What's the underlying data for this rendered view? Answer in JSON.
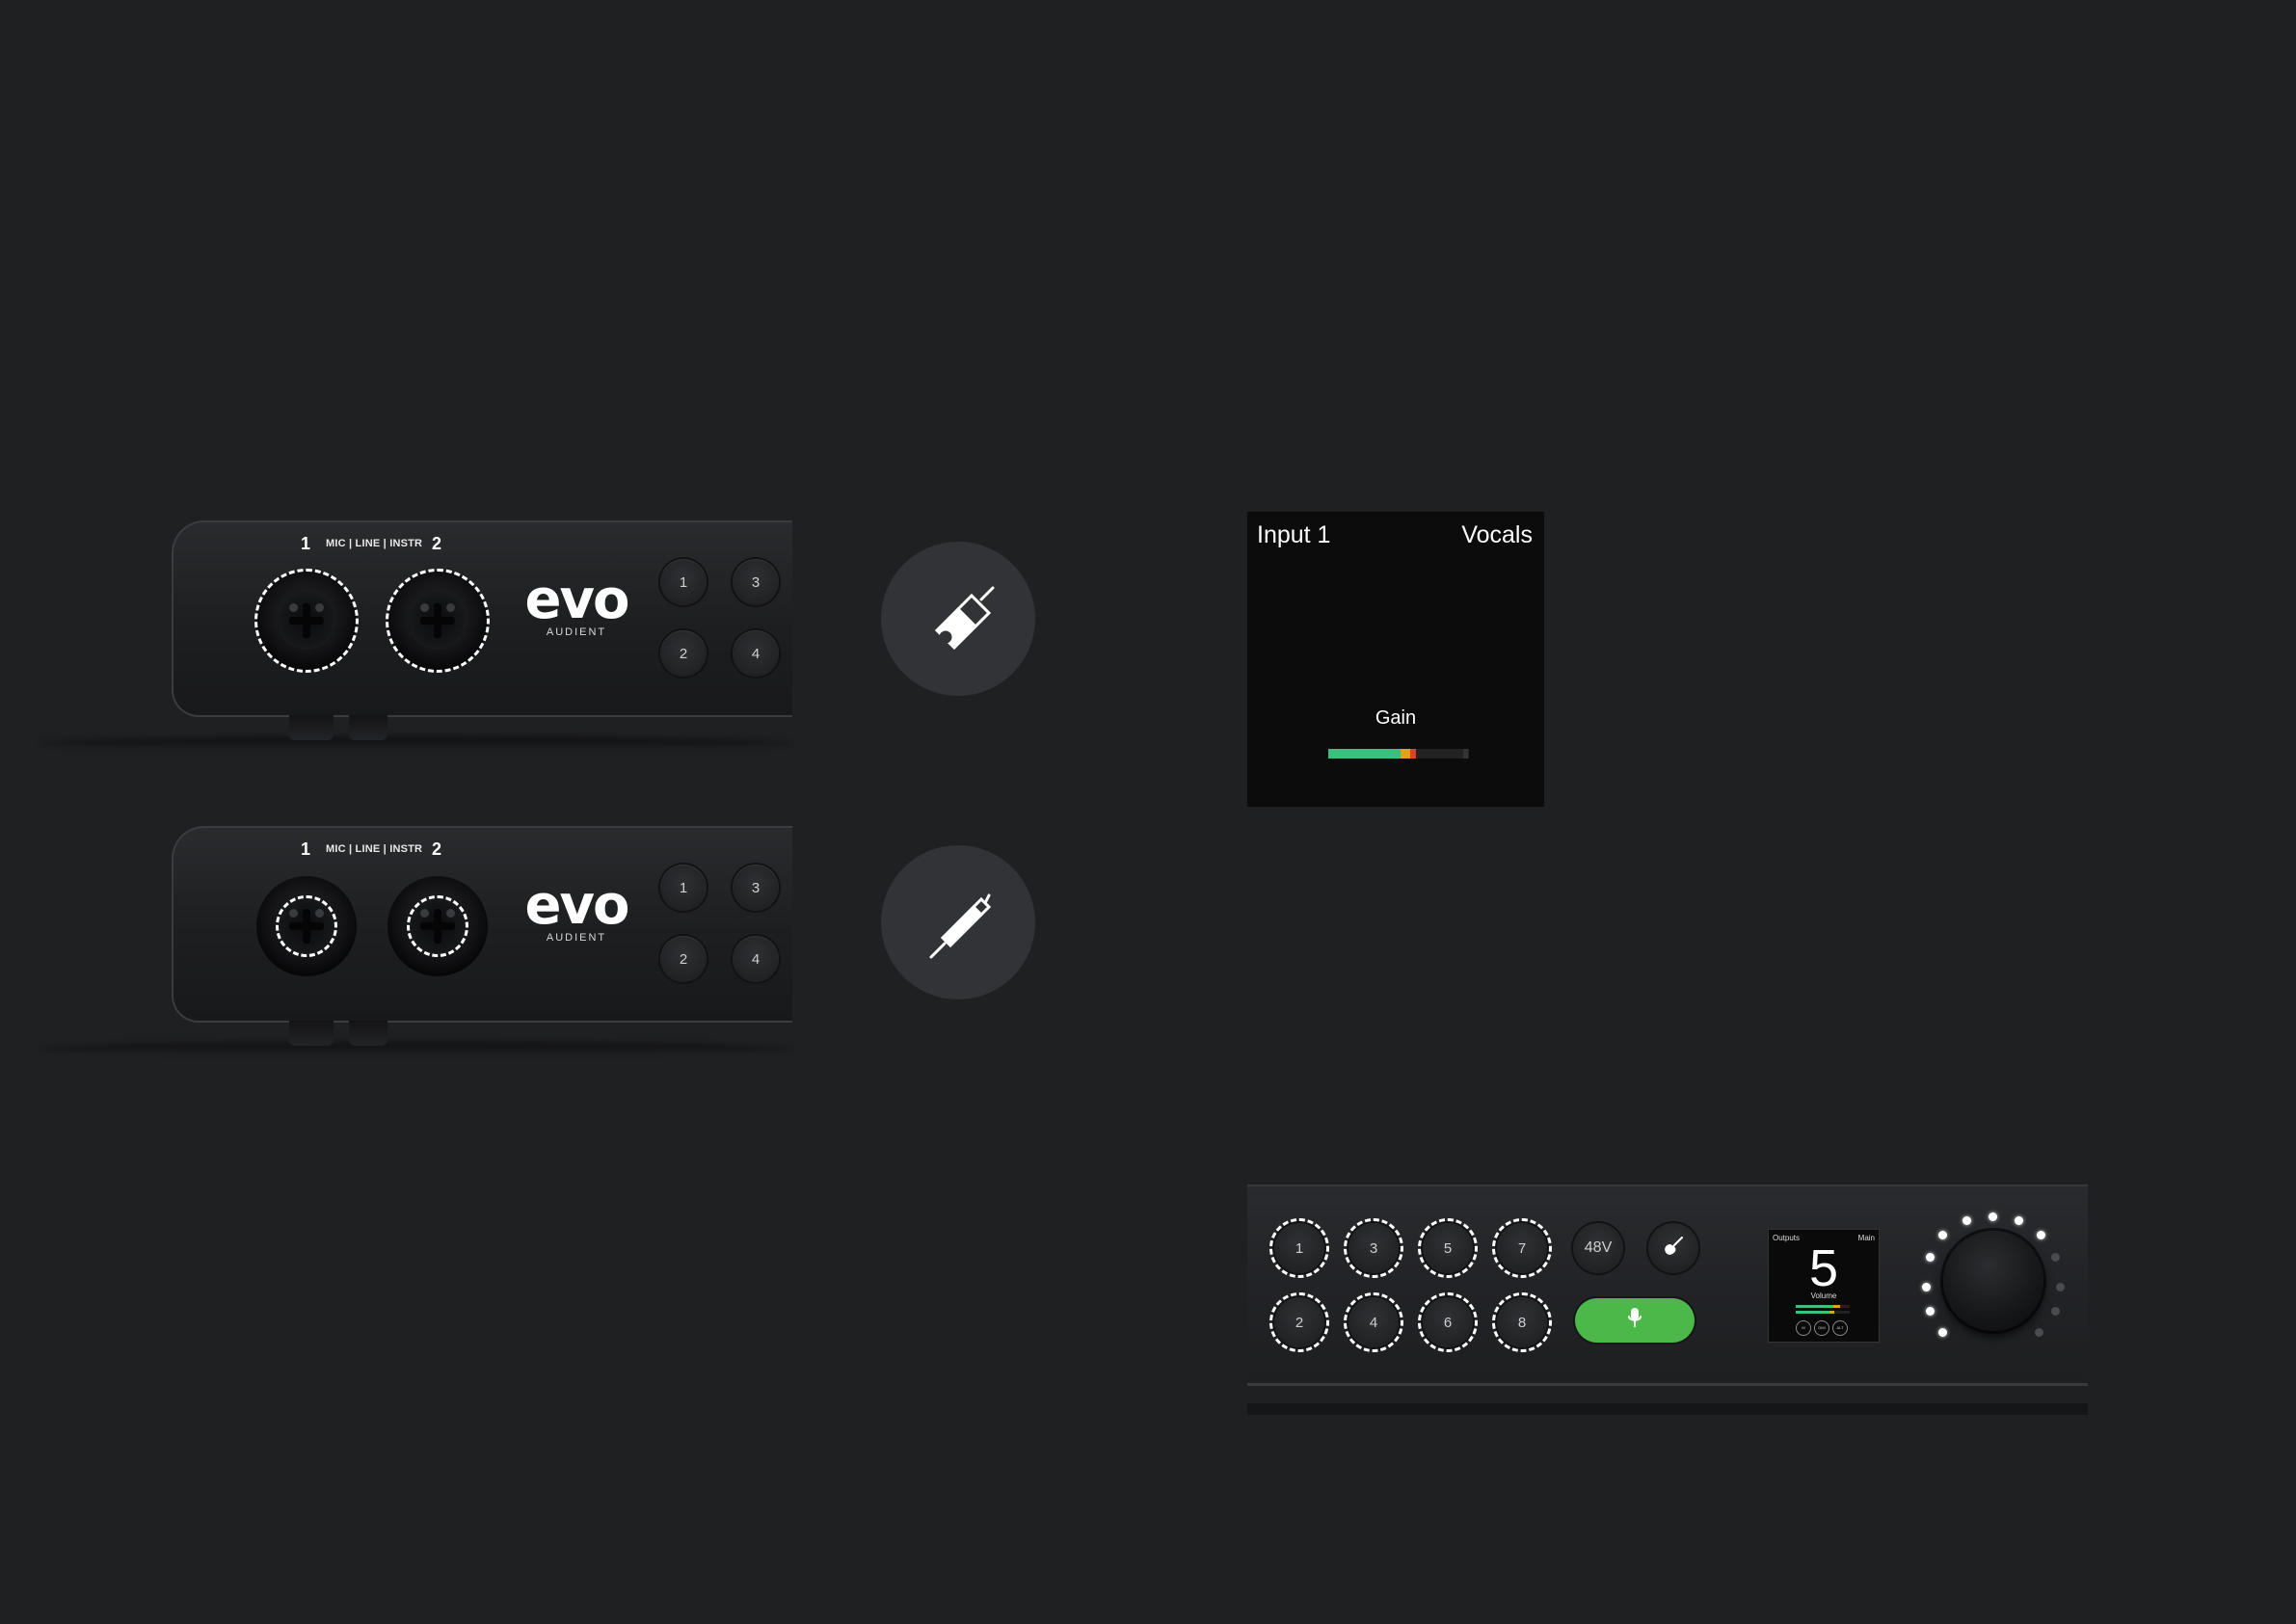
{
  "devices": [
    {
      "channel_1": "1",
      "channel_2": "2",
      "input_types": "MIC | LINE | INSTR",
      "logo": "evo",
      "brand": "AUDIENT",
      "buttons": [
        "1",
        "3",
        "2",
        "4"
      ],
      "highlight": "xlr-ring",
      "cable_icon": "xlr-connector-icon"
    },
    {
      "channel_1": "1",
      "channel_2": "2",
      "input_types": "MIC | LINE | INSTR",
      "logo": "evo",
      "brand": "AUDIENT",
      "buttons": [
        "1",
        "3",
        "2",
        "4"
      ],
      "highlight": "jack-ring",
      "cable_icon": "jack-plug-icon"
    }
  ],
  "screen": {
    "input": "Input 1",
    "name": "Vocals",
    "parameter": "Gain",
    "meter_level": 0.62,
    "meter_colors": {
      "green": "#3fbf7f",
      "amber": "#e0a020",
      "red": "#d9442c",
      "off": "#262626"
    }
  },
  "top_panel": {
    "channel_buttons": [
      "1",
      "3",
      "5",
      "7",
      "2",
      "4",
      "6",
      "8"
    ],
    "phantom_label": "48V",
    "instrument_icon": "guitar-icon",
    "mic_button_icon": "microphone-icon",
    "mini_screen": {
      "left": "Outputs",
      "right": "Main",
      "value": "5",
      "label": "Volume",
      "icons": [
        "M",
        "DIM",
        "ALT"
      ]
    },
    "accent": "#4cb84a"
  }
}
